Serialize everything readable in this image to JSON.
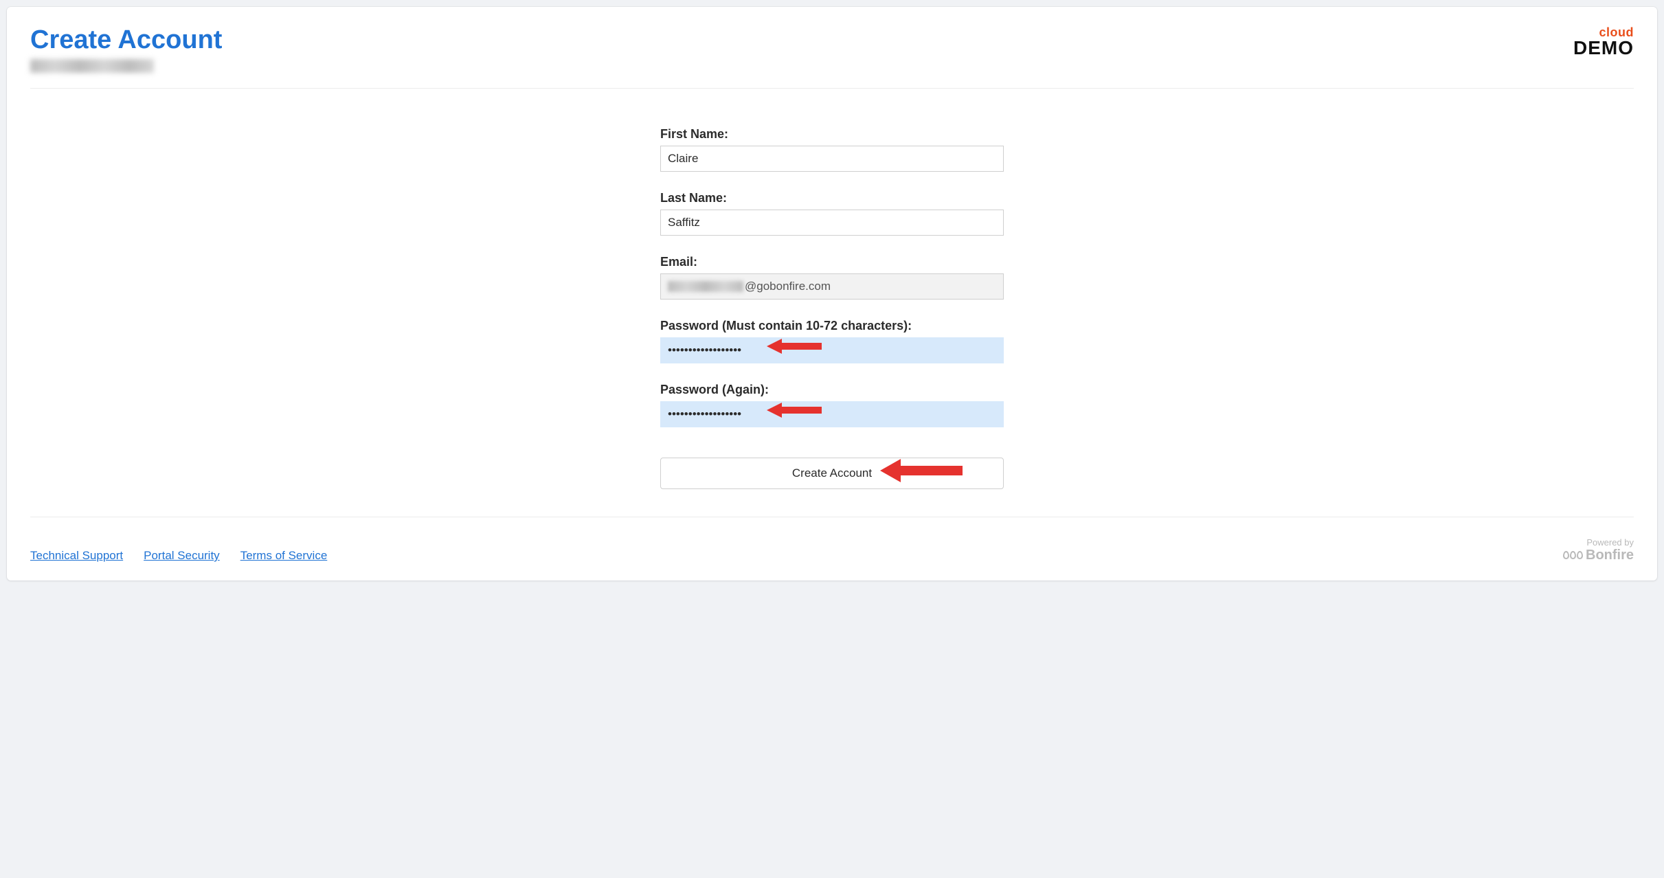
{
  "header": {
    "title": "Create Account",
    "logo_top": "cloud",
    "logo_bottom": "DEMO"
  },
  "form": {
    "first_name": {
      "label": "First Name:",
      "value": "Claire"
    },
    "last_name": {
      "label": "Last Name:",
      "value": "Saffitz"
    },
    "email": {
      "label": "Email:",
      "value_suffix": "@gobonfire.com"
    },
    "password": {
      "label": "Password (Must contain 10-72 characters):",
      "value": "••••••••••••••••••"
    },
    "password2": {
      "label": "Password (Again):",
      "value": "••••••••••••••••••"
    },
    "submit_label": "Create Account"
  },
  "footer": {
    "links": {
      "support": "Technical Support",
      "security": "Portal Security",
      "tos": "Terms of Service"
    },
    "powered_by": "Powered by",
    "brand": "Bonfire"
  }
}
